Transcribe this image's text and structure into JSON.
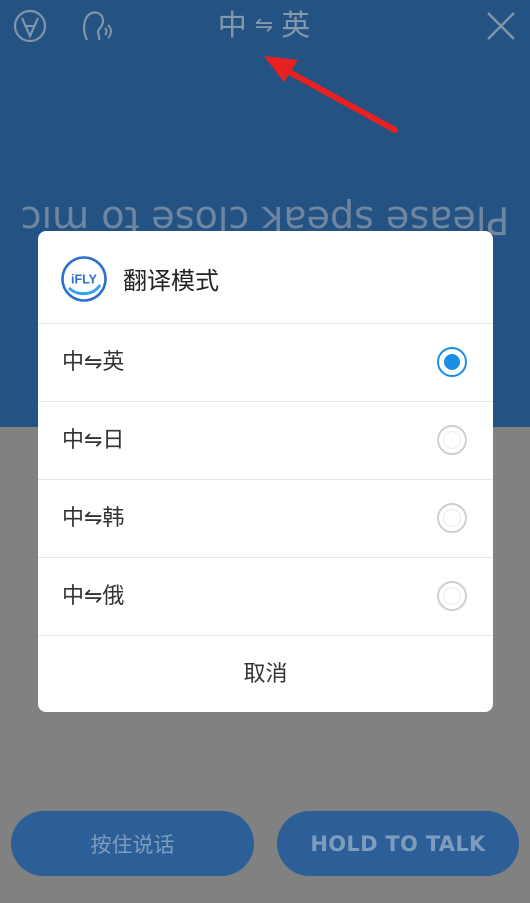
{
  "header": {
    "lang_left": "中",
    "lang_sep": "⇋",
    "lang_right": "英",
    "left_icon_1": "check-circle-icon",
    "left_icon_2": "speaker-voice-icon",
    "right_icon": "close-icon"
  },
  "prompt": {
    "mirrored_text": "Please speak close to mic"
  },
  "annotation": {
    "arrow_color": "#e82020"
  },
  "dialog": {
    "logo_text": "iFLY",
    "title": "翻译模式",
    "options": [
      {
        "label": "中⇋英",
        "selected": true
      },
      {
        "label": "中⇋日",
        "selected": false
      },
      {
        "label": "中⇋韩",
        "selected": false
      },
      {
        "label": "中⇋俄",
        "selected": false
      }
    ],
    "cancel_label": "取消"
  },
  "buttons": {
    "hold_cn": "按住说话",
    "hold_en": "HOLD TO TALK"
  },
  "colors": {
    "top_bg": "#245283",
    "overlay_bg": "#818181",
    "accent": "#1a8fe6",
    "button_bg": "#2c5f98"
  }
}
